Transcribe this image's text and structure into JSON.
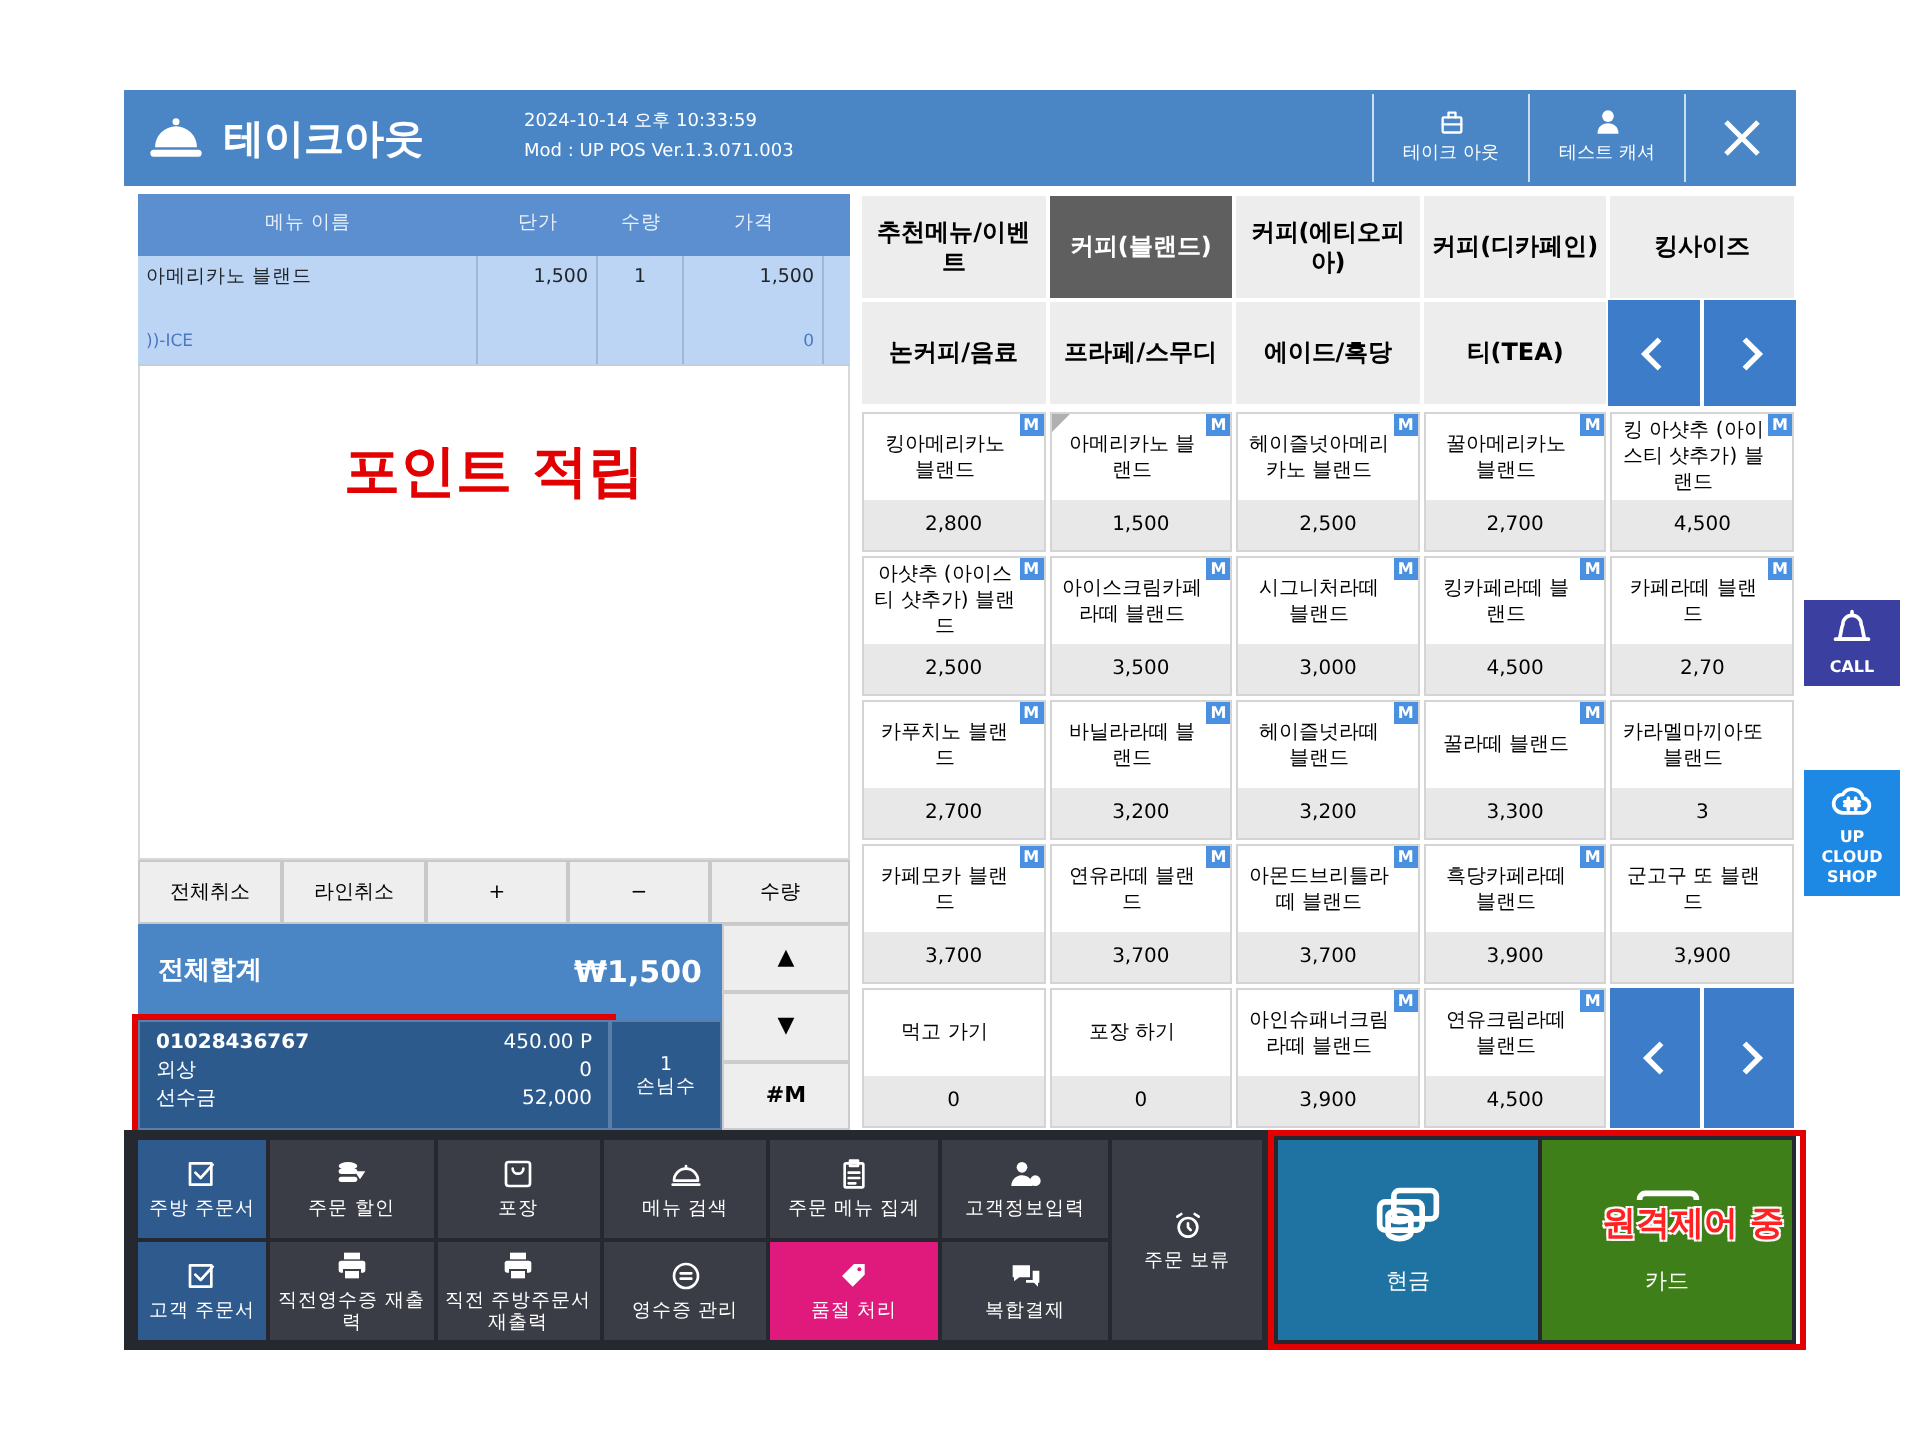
{
  "header": {
    "title": "테이크아웃",
    "datetime": "2024-10-14 오후 10:33:59",
    "version": "Mod : UP POS Ver.1.3.071.003",
    "buttons": [
      {
        "label": "테이크 아웃"
      },
      {
        "label": "테스트 캐셔"
      }
    ]
  },
  "order_table": {
    "columns": [
      "메뉴 이름",
      "단가",
      "수량",
      "가격"
    ],
    "rows": [
      {
        "name": "아메리카노 블랜드",
        "unit_price": "1,500",
        "qty": "1",
        "price": "1,500",
        "option": "))-ICE",
        "option_price": "0",
        "selected": true
      }
    ]
  },
  "annotation": "포인트 적립",
  "order_actions": [
    "전체취소",
    "라인취소",
    "+",
    "−",
    "수량"
  ],
  "total": {
    "label": "전체합계",
    "amount": "₩1,500"
  },
  "customer": {
    "phone": "01028436767",
    "points": "450.00 P",
    "highlighted": true,
    "rows": [
      {
        "label": "외상",
        "value": "0"
      },
      {
        "label": "선수금",
        "value": "52,000"
      }
    ]
  },
  "guests": {
    "count": "1",
    "label": "손님수"
  },
  "side_buttons": [
    "▲",
    "▼",
    "#M"
  ],
  "categories": [
    {
      "label": "추천메뉴/이벤트",
      "selected": false
    },
    {
      "label": "커피(블랜드)",
      "selected": true
    },
    {
      "label": "커피(에티오피아)",
      "selected": false
    },
    {
      "label": "커피(디카페인)",
      "selected": false
    },
    {
      "label": "킹사이즈",
      "selected": false
    },
    {
      "label": "논커피/음료",
      "selected": false
    },
    {
      "label": "프라페/스무디",
      "selected": false
    },
    {
      "label": "에이드/흑당",
      "selected": false
    },
    {
      "label": "티(TEA)",
      "selected": false
    }
  ],
  "menu_items": [
    {
      "name": "킹아메리카노 블랜드",
      "price": "2,800",
      "badge": "M",
      "flag": false
    },
    {
      "name": "아메리카노 블랜드",
      "price": "1,500",
      "badge": "M",
      "flag": true
    },
    {
      "name": "헤이즐넛아메리카노 블랜드",
      "price": "2,500",
      "badge": "M",
      "flag": false
    },
    {
      "name": "꿀아메리카노 블랜드",
      "price": "2,700",
      "badge": "M",
      "flag": false
    },
    {
      "name": "킹 아샷추 (아이스티 샷추가) 블랜드",
      "price": "4,500",
      "badge": "M",
      "flag": false
    },
    {
      "name": "아샷추 (아이스티 샷추가) 블랜드",
      "price": "2,500",
      "badge": "M",
      "flag": false
    },
    {
      "name": "아이스크림카페라떼 블랜드",
      "price": "3,500",
      "badge": "M",
      "flag": false
    },
    {
      "name": "시그니처라떼 블랜드",
      "price": "3,000",
      "badge": "M",
      "flag": false
    },
    {
      "name": "킹카페라떼 블랜드",
      "price": "4,500",
      "badge": "M",
      "flag": false
    },
    {
      "name": "카페라떼 블랜드",
      "price": "2,70",
      "badge": "M",
      "flag": false
    },
    {
      "name": "카푸치노 블랜드",
      "price": "2,700",
      "badge": "M",
      "flag": false
    },
    {
      "name": "바닐라라떼 블랜드",
      "price": "3,200",
      "badge": "M",
      "flag": false
    },
    {
      "name": "헤이즐넛라떼 블랜드",
      "price": "3,200",
      "badge": "M",
      "flag": false
    },
    {
      "name": "꿀라떼 블랜드",
      "price": "3,300",
      "badge": "M",
      "flag": false
    },
    {
      "name": "카라멜마끼아또 블랜드",
      "price": "3",
      "flag": false
    },
    {
      "name": "카페모카 블랜드",
      "price": "3,700",
      "badge": "M",
      "flag": false
    },
    {
      "name": "연유라떼 블랜드",
      "price": "3,700",
      "badge": "M",
      "flag": false
    },
    {
      "name": "아몬드브리틀라떼 블랜드",
      "price": "3,700",
      "badge": "M",
      "flag": false
    },
    {
      "name": "흑당카페라떼 블랜드",
      "price": "3,900",
      "badge": "M",
      "flag": false
    },
    {
      "name": "군고구 또 블랜드",
      "price": "3,900",
      "flag": false
    },
    {
      "name": "먹고 가기",
      "price": "0",
      "flag": false
    },
    {
      "name": "포장 하기",
      "price": "0",
      "flag": false
    },
    {
      "name": "아인슈패너크림라떼 블랜드",
      "price": "3,900",
      "badge": "M",
      "flag": false
    },
    {
      "name": "연유크림라떼 블랜드",
      "price": "4,500",
      "badge": "M",
      "flag": false
    }
  ],
  "toolbar": [
    [
      {
        "label": "주방 주문서",
        "kind": "check",
        "checked": true
      },
      {
        "label": "고객 주문서",
        "kind": "check",
        "checked": true
      }
    ],
    [
      {
        "label": "주문 할인",
        "kind": "discount"
      },
      {
        "label": "직전영수증 재출력",
        "kind": "print"
      }
    ],
    [
      {
        "label": "포장",
        "kind": "bag"
      },
      {
        "label": "직전 주방주문서 재출력",
        "kind": "print"
      }
    ],
    [
      {
        "label": "메뉴 검색",
        "kind": "cloche"
      },
      {
        "label": "영수증 관리",
        "kind": "receipt"
      }
    ],
    [
      {
        "label": "주문 메뉴 집계",
        "kind": "clipboard"
      },
      {
        "label": "품절 처리",
        "kind": "tag",
        "highlighted": true
      }
    ],
    [
      {
        "label": "고객정보입력",
        "kind": "user"
      },
      {
        "label": "복합결제",
        "kind": "chat"
      }
    ],
    [
      {
        "label": "주문 보류",
        "kind": "alarm"
      }
    ]
  ],
  "payments": {
    "highlighted": true,
    "items": [
      {
        "label": "현금",
        "kind": "cash"
      },
      {
        "label": "카드",
        "kind": "card"
      }
    ],
    "notice": "원격제어 중"
  },
  "widgets": [
    {
      "label": "CALL",
      "kind": "bell"
    },
    {
      "label": "UP CLOUD SHOP",
      "kind": "cloud"
    }
  ]
}
